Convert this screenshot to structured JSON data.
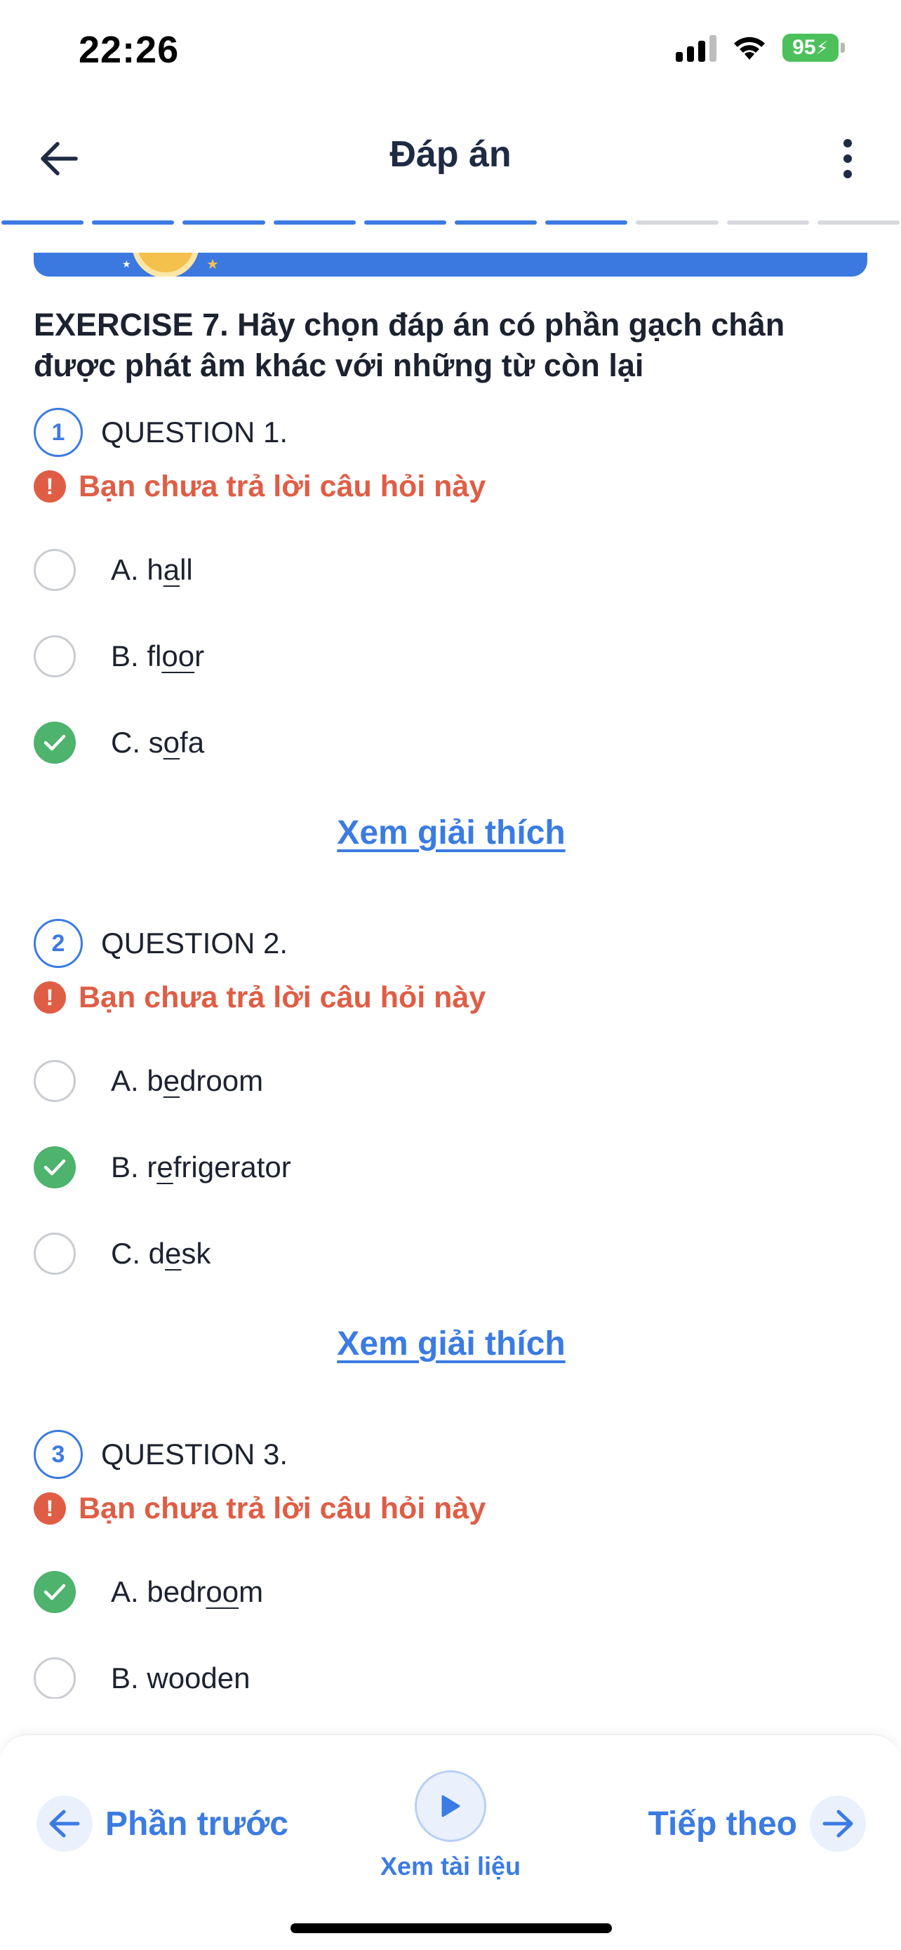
{
  "status_bar": {
    "time": "22:26",
    "battery": "95"
  },
  "header": {
    "title": "Đáp án"
  },
  "progress": {
    "total": 10,
    "completed": 7
  },
  "exercise": {
    "title": "EXERCISE 7. Hãy chọn đáp án có phần gạch chân được phát âm khác với những từ còn lại"
  },
  "questions": [
    {
      "number": "1",
      "label": "QUESTION 1.",
      "warning": "Bạn chưa trả lời câu hỏi này",
      "options": [
        {
          "prefix": "A. ",
          "pre": "h",
          "underline": "a",
          "post": "ll",
          "correct": false
        },
        {
          "prefix": "B. ",
          "pre": "fl",
          "underline": "oo",
          "post": "r",
          "correct": false
        },
        {
          "prefix": "C. ",
          "pre": "s",
          "underline": "o",
          "post": "fa",
          "correct": true
        }
      ],
      "explain": "Xem giải thích"
    },
    {
      "number": "2",
      "label": "QUESTION 2.",
      "warning": "Bạn chưa trả lời câu hỏi này",
      "options": [
        {
          "prefix": "A. ",
          "pre": "b",
          "underline": "e",
          "post": "droom",
          "correct": false
        },
        {
          "prefix": "B. ",
          "pre": "r",
          "underline": "e",
          "post": "frigerator",
          "correct": true
        },
        {
          "prefix": "C. ",
          "pre": "d",
          "underline": "e",
          "post": "sk",
          "correct": false
        }
      ],
      "explain": "Xem giải thích"
    },
    {
      "number": "3",
      "label": "QUESTION 3.",
      "warning": "Bạn chưa trả lời câu hỏi này",
      "options": [
        {
          "prefix": "A. ",
          "pre": "bedr",
          "underline": "oo",
          "post": "m",
          "correct": true
        },
        {
          "prefix": "B. ",
          "pre": "wooden",
          "underline": "",
          "post": "",
          "correct": false
        }
      ]
    }
  ],
  "bottom_bar": {
    "prev_label": "Phần trước",
    "docs_label": "Xem tài liệu",
    "next_label": "Tiếp theo"
  },
  "colors": {
    "accent": "#3b7be3",
    "correct": "#4db36d",
    "warning": "#e05d45",
    "battery": "#4cc05a"
  }
}
